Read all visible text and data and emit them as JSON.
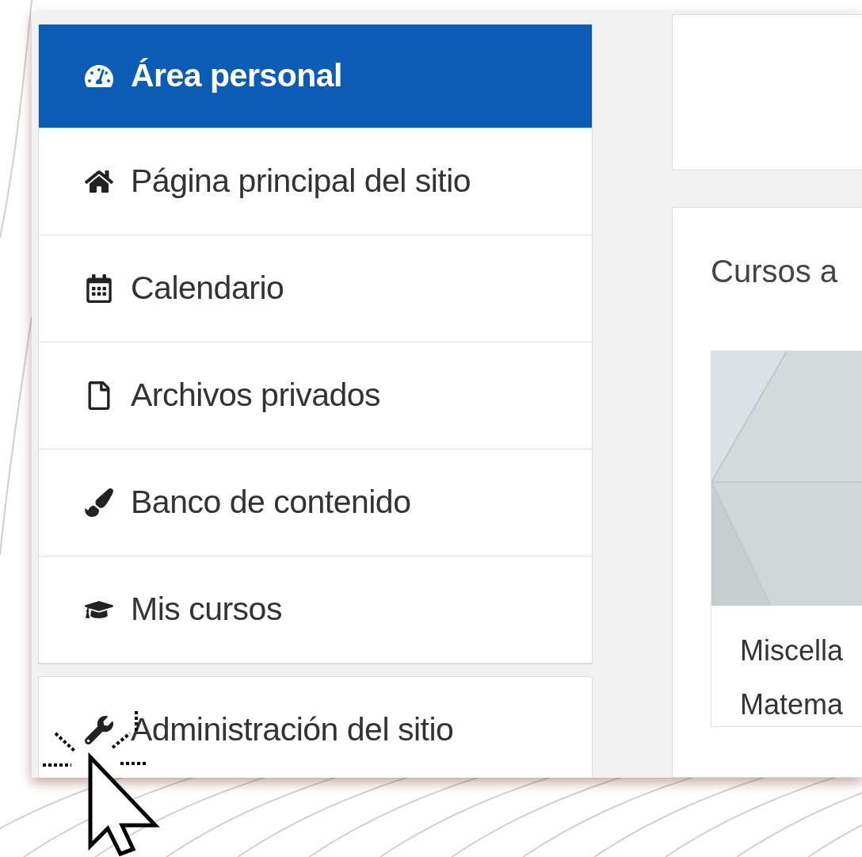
{
  "nav": [
    {
      "label": "Área personal",
      "kind": "dashboard",
      "selected": true
    },
    {
      "label": "Página principal del sitio",
      "kind": "home",
      "selected": false
    },
    {
      "label": "Calendario",
      "kind": "calendar",
      "selected": false
    },
    {
      "label": "Archivos privados",
      "kind": "file",
      "selected": false
    },
    {
      "label": "Banco de contenido",
      "kind": "brush",
      "selected": false
    },
    {
      "label": "Mis cursos",
      "kind": "cap",
      "selected": false
    }
  ],
  "admin_nav": [
    {
      "label": "Administración del sitio",
      "kind": "wrench",
      "selected": false
    }
  ],
  "courses_card": {
    "title": "Cursos a",
    "course": {
      "category": "Miscella",
      "name": "Matema"
    }
  }
}
